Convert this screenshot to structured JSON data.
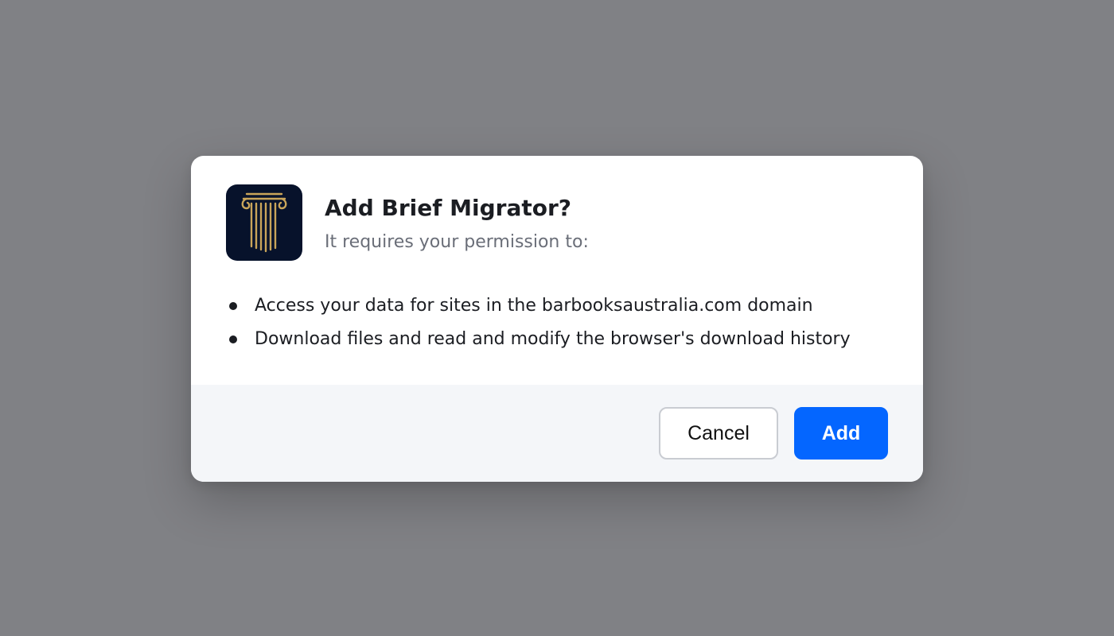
{
  "dialog": {
    "title": "Add Brief Migrator?",
    "subtitle": "It requires your permission to:",
    "icon": "greek-column-icon",
    "permissions": [
      "Access your data for sites in the barbooksaustralia.com domain",
      "Download files and read and modify the browser's download history"
    ],
    "buttons": {
      "cancel_label": "Cancel",
      "add_label": "Add"
    }
  },
  "colors": {
    "overlay": "#808185",
    "icon_bg": "#07122b",
    "icon_gold": "#c9a55a",
    "primary": "#0466ff",
    "footer_bg": "#f4f6f9"
  }
}
